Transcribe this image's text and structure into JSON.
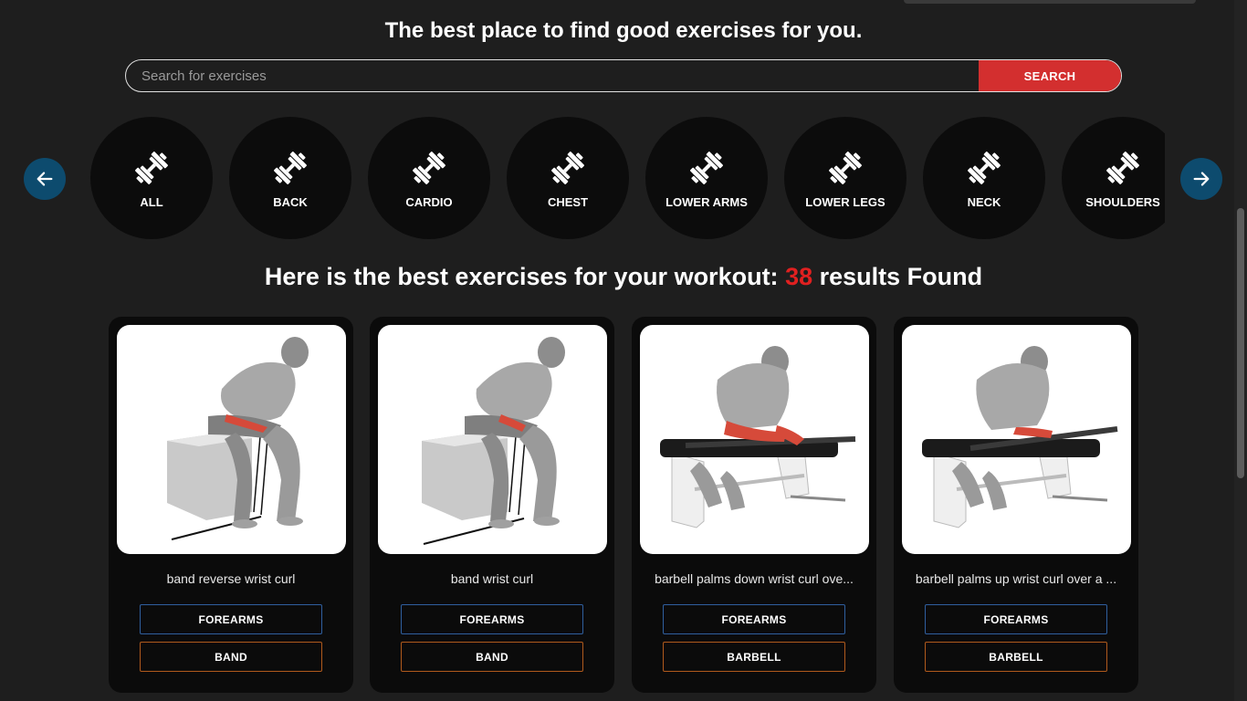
{
  "hero": {
    "title": "The best place to find good exercises for you."
  },
  "search": {
    "placeholder": "Search for exercises",
    "button_label": "SEARCH"
  },
  "categories": [
    {
      "label": "ALL",
      "icon": "dumbbell-icon"
    },
    {
      "label": "BACK",
      "icon": "dumbbell-icon"
    },
    {
      "label": "CARDIO",
      "icon": "dumbbell-icon"
    },
    {
      "label": "CHEST",
      "icon": "dumbbell-icon"
    },
    {
      "label": "LOWER ARMS",
      "icon": "dumbbell-icon"
    },
    {
      "label": "LOWER LEGS",
      "icon": "dumbbell-icon"
    },
    {
      "label": "NECK",
      "icon": "dumbbell-icon"
    },
    {
      "label": "SHOULDERS",
      "icon": "dumbbell-icon"
    }
  ],
  "navigation": {
    "prev_icon": "arrow-left-icon",
    "next_icon": "arrow-right-icon"
  },
  "results": {
    "prefix": "Here is the best exercises for your workout: ",
    "count": "38",
    "suffix": " results Found"
  },
  "exercises": [
    {
      "name": "band reverse wrist curl",
      "body_part": "FOREARMS",
      "equipment": "BAND"
    },
    {
      "name": "band wrist curl",
      "body_part": "FOREARMS",
      "equipment": "BAND"
    },
    {
      "name": "barbell palms down wrist curl ove...",
      "body_part": "FOREARMS",
      "equipment": "BARBELL"
    },
    {
      "name": "barbell palms up wrist curl over a ...",
      "body_part": "FOREARMS",
      "equipment": "BARBELL"
    }
  ],
  "colors": {
    "background": "#1e1e1e",
    "accent_red": "#d32f2f",
    "arrow_blue": "#0d4b6e",
    "tag_body_border": "#2f5f9e",
    "tag_equipment_border": "#b05a1c"
  }
}
